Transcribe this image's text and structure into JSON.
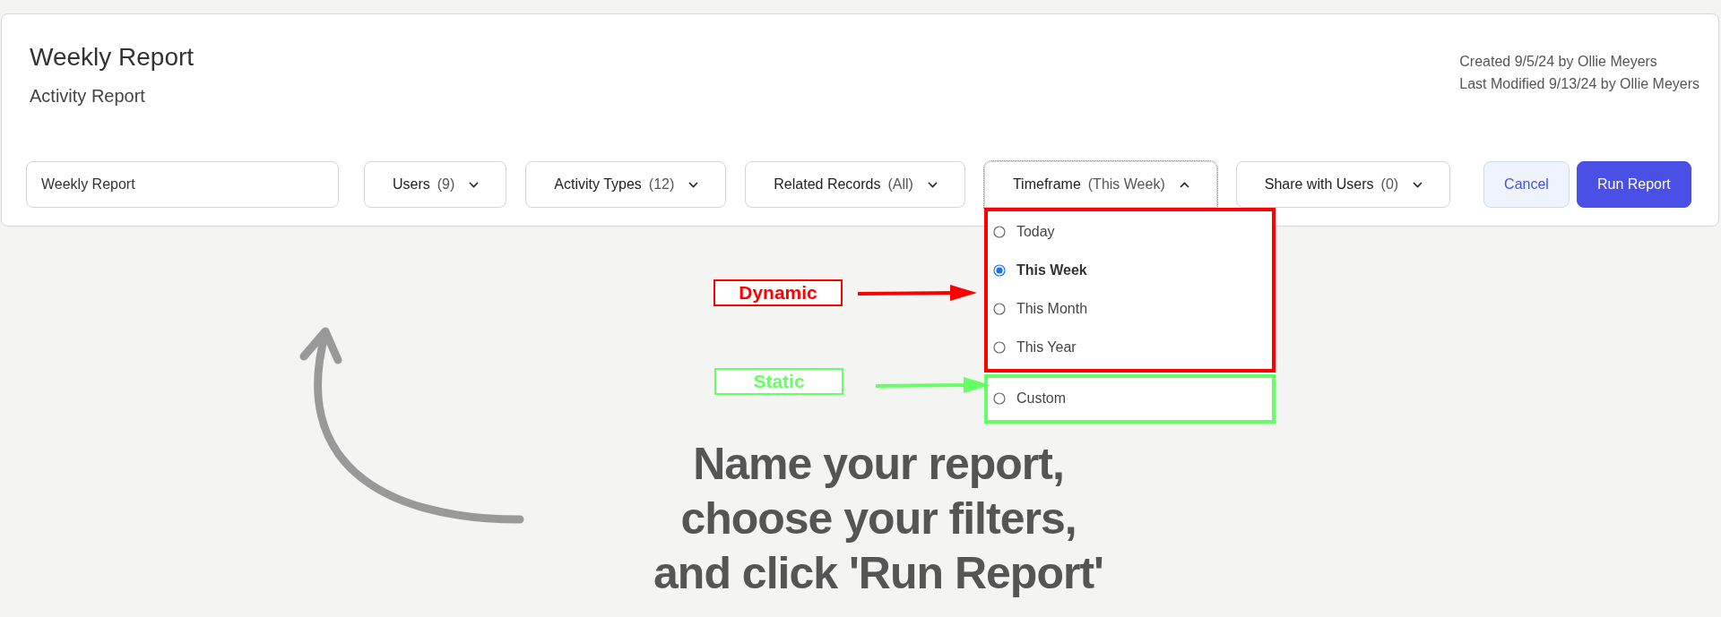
{
  "report": {
    "title": "Weekly Report",
    "subtitle": "Activity Report",
    "created": "Created 9/5/24 by Ollie Meyers",
    "modified": "Last Modified 9/13/24 by Ollie Meyers"
  },
  "name_field": {
    "value": "Weekly Report"
  },
  "filters": [
    {
      "label": "Users",
      "count": "(9)",
      "expanded": false
    },
    {
      "label": "Activity Types",
      "count": "(12)",
      "expanded": false
    },
    {
      "label": "Related Records",
      "count": "(All)",
      "expanded": false
    },
    {
      "label": "Timeframe",
      "count": "(This Week)",
      "expanded": true
    },
    {
      "label": "Share with Users",
      "count": "(0)",
      "expanded": false
    }
  ],
  "buttons": [
    {
      "label": "Cancel",
      "kind": "secondary"
    },
    {
      "label": "Run Report",
      "kind": "primary"
    }
  ],
  "timeframe_groups": [
    {
      "kind": "dynamic",
      "label": "Dynamic",
      "options": [
        {
          "label": "Today",
          "selected": false
        },
        {
          "label": "This Week",
          "selected": true
        },
        {
          "label": "This Month",
          "selected": false
        },
        {
          "label": "This Year",
          "selected": false
        }
      ]
    },
    {
      "kind": "static",
      "label": "Static",
      "options": [
        {
          "label": "Custom",
          "selected": false
        }
      ]
    }
  ],
  "instructions": [
    "Name your report,",
    "choose your filters,",
    "and click 'Run Report'"
  ]
}
